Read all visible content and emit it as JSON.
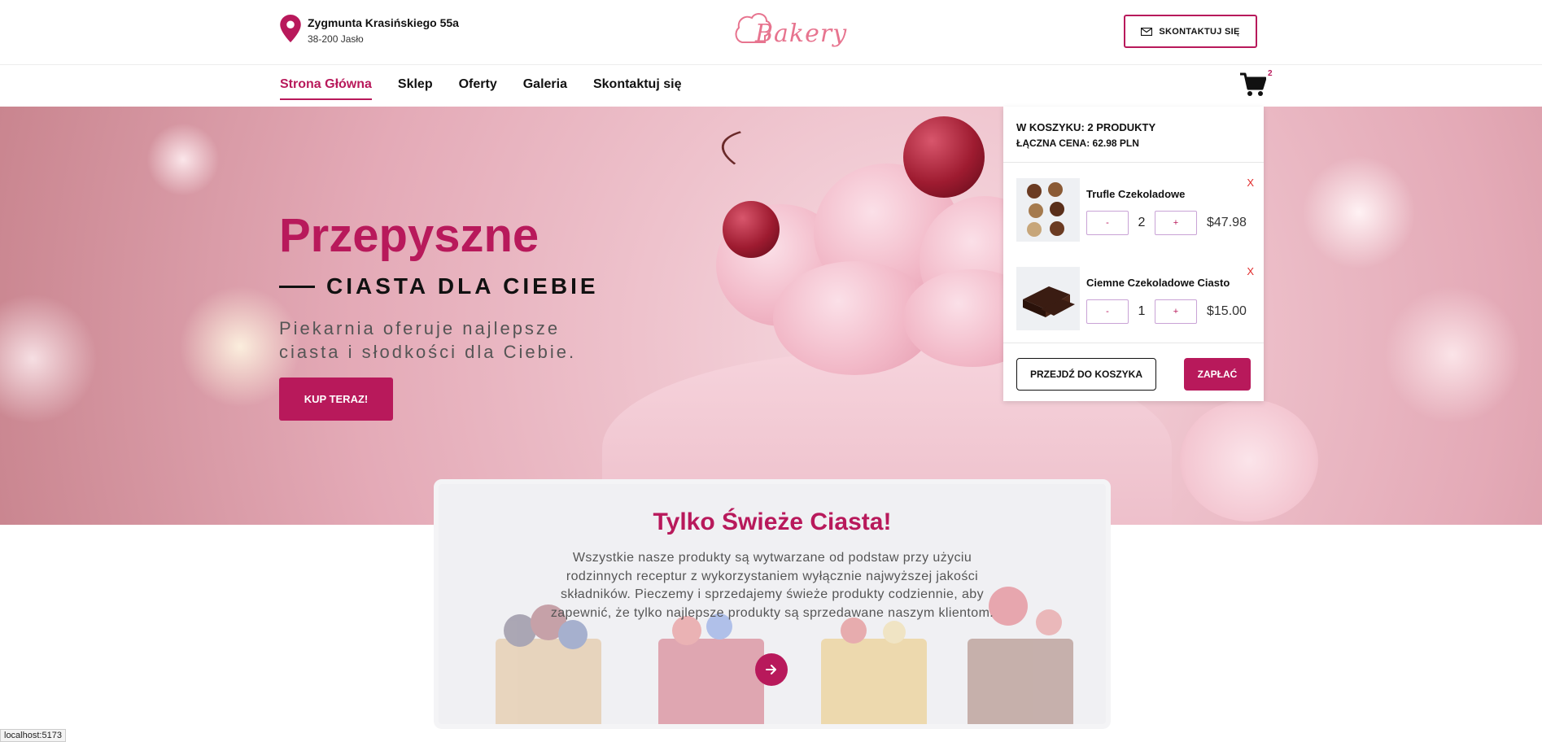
{
  "header": {
    "address_line1": "Zygmunta Krasińskiego 55a",
    "address_line2": "38-200 Jasło",
    "logo_text": "Bakery",
    "contact_button": "SKONTAKTUJ SIĘ"
  },
  "nav": {
    "items": [
      {
        "label": "Strona Główna",
        "active": true
      },
      {
        "label": "Sklep",
        "active": false
      },
      {
        "label": "Oferty",
        "active": false
      },
      {
        "label": "Galeria",
        "active": false
      },
      {
        "label": "Skontaktuj się",
        "active": false
      }
    ],
    "cart_count": "2"
  },
  "hero": {
    "title": "Przepyszne",
    "subtitle": "CIASTA DLA CIEBIE",
    "description": "Piekarnia oferuje najlepsze ciasta i słodkości dla Ciebie.",
    "buy_button": "KUP TERAZ!"
  },
  "cart": {
    "summary": "W KOSZYKU: 2 PRODUKTY",
    "total": "ŁĄCZNA CENA: 62.98 PLN",
    "items": [
      {
        "name": "Trufle Czekoladowe",
        "qty": "2",
        "price": "$47.98",
        "minus": "-",
        "plus": "+",
        "remove": "X"
      },
      {
        "name": "Ciemne Czekoladowe Ciasto",
        "qty": "1",
        "price": "$15.00",
        "minus": "-",
        "plus": "+",
        "remove": "X"
      }
    ],
    "go_to_cart": "PRZEJDŹ DO KOSZYKA",
    "pay": "ZAPŁAĆ"
  },
  "feature": {
    "title": "Tylko Świeże Ciasta!",
    "text": "Wszystkie nasze produkty są wytwarzane od podstaw przy użyciu rodzinnych receptur z wykorzystaniem wyłącznie najwyższej jakości składników. Pieczemy i sprzedajemy świeże produkty codziennie, aby zapewnić, że tylko najlepsze produkty są sprzedawane naszym klientom."
  },
  "status_bar": "localhost:5173",
  "colors": {
    "accent": "#b8195b",
    "remove": "#e02b2b",
    "logo": "#e7748f"
  },
  "icons": [
    "map-pin-icon",
    "mail-icon",
    "cart-icon",
    "arrow-right-icon"
  ]
}
